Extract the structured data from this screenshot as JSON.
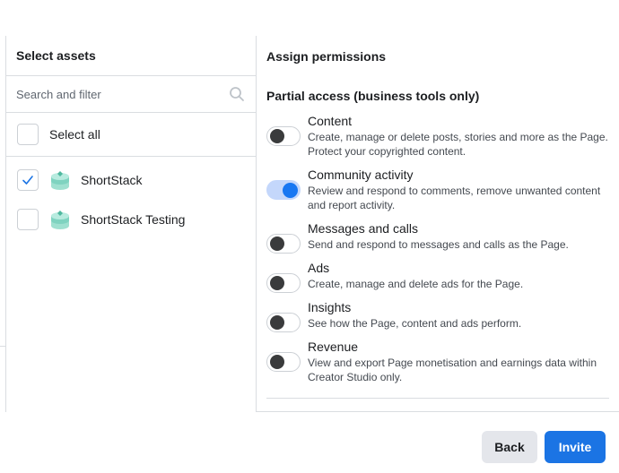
{
  "assets_panel": {
    "title": "Select assets",
    "search_placeholder": "Search and filter",
    "select_all_label": "Select all",
    "items": [
      {
        "name": "ShortStack",
        "checked": true,
        "icon": "shortstack-logo-icon"
      },
      {
        "name": "ShortStack Testing",
        "checked": false,
        "icon": "shortstack-logo-icon"
      }
    ]
  },
  "permissions_panel": {
    "title": "Assign permissions",
    "section_title": "Partial access (business tools only)",
    "items": [
      {
        "title": "Content",
        "description": "Create, manage or delete posts, stories and more as the Page. Protect your copyrighted content.",
        "enabled": false
      },
      {
        "title": "Community activity",
        "description": "Review and respond to comments, remove unwanted content and report activity.",
        "enabled": true
      },
      {
        "title": "Messages and calls",
        "description": "Send and respond to messages and calls as the Page.",
        "enabled": false
      },
      {
        "title": "Ads",
        "description": "Create, manage and delete ads for the Page.",
        "enabled": false
      },
      {
        "title": "Insights",
        "description": "See how the Page, content and ads perform.",
        "enabled": false
      },
      {
        "title": "Revenue",
        "description": "View and export Page monetisation and earnings data within Creator Studio only.",
        "enabled": false
      }
    ]
  },
  "footer": {
    "back_label": "Back",
    "invite_label": "Invite"
  },
  "colors": {
    "primary": "#1b74e4",
    "toggle_on_track": "#c4d7fb",
    "toggle_off_knob": "#3a3b3c",
    "asset_icon": "#7fd3c0"
  }
}
